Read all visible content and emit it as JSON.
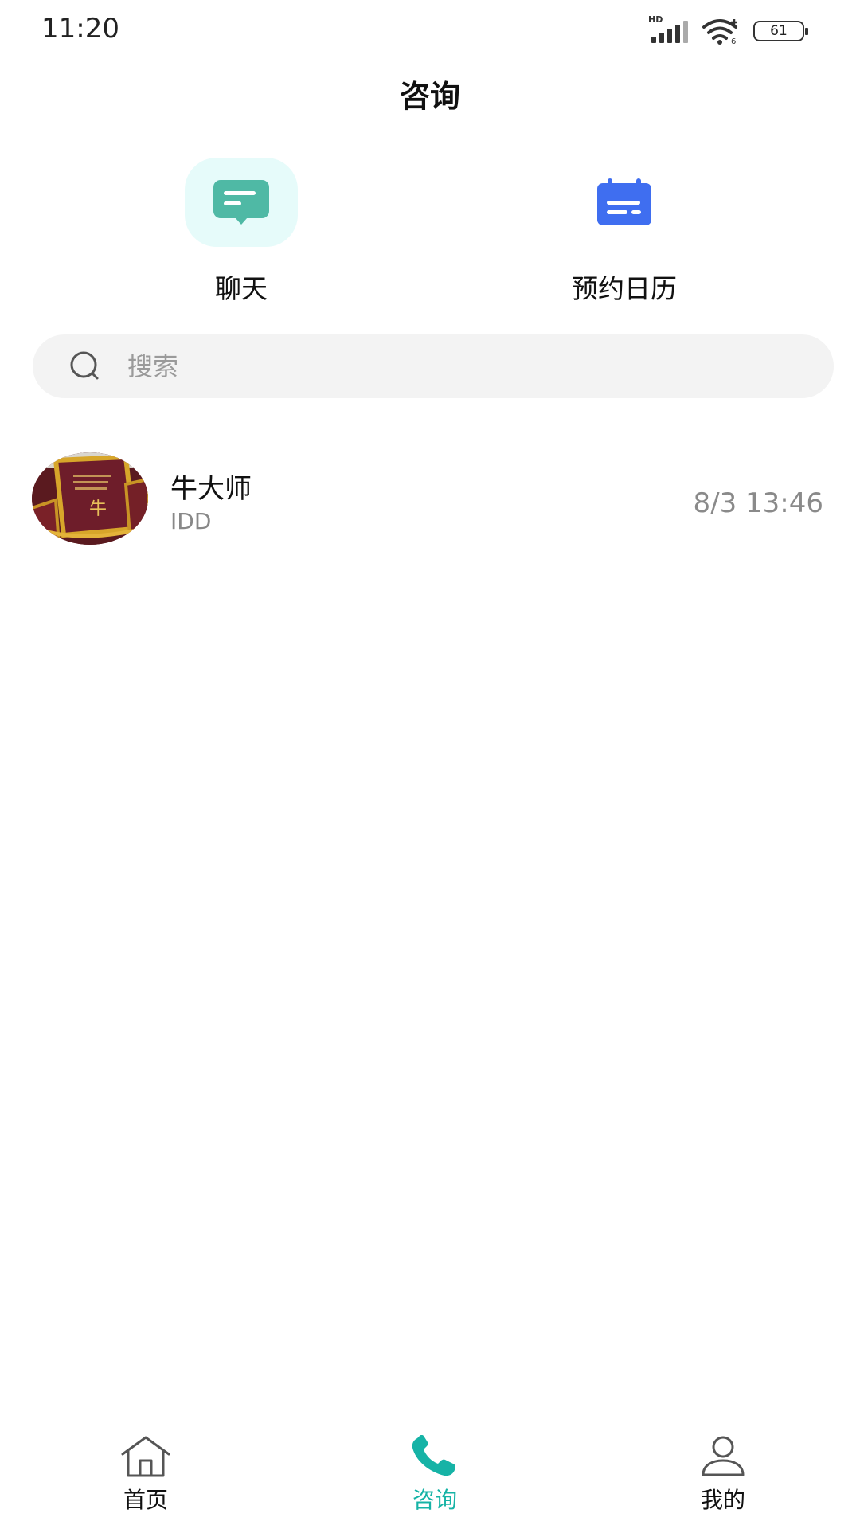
{
  "status_bar": {
    "time": "11:20",
    "battery": "61",
    "signal_badge": "HD"
  },
  "header": {
    "title": "咨询"
  },
  "quick_actions": [
    {
      "label": "聊天",
      "icon": "chat-bubble-icon",
      "color": "#4fb9a5",
      "bg": "#e6fbfa"
    },
    {
      "label": "预约日历",
      "icon": "calendar-icon",
      "color": "#3f6ef0"
    }
  ],
  "search": {
    "placeholder": "搜索",
    "value": ""
  },
  "conversations": [
    {
      "name": "牛大师",
      "subtitle": "IDD",
      "time": "8/3 13:46",
      "avatar": "avatar-photo"
    }
  ],
  "bottom_nav": {
    "items": [
      {
        "label": "首页",
        "icon": "home-icon",
        "active": false
      },
      {
        "label": "咨询",
        "icon": "phone-icon",
        "active": true
      },
      {
        "label": "我的",
        "icon": "person-icon",
        "active": false
      }
    ],
    "active_color": "#16b3a6"
  }
}
